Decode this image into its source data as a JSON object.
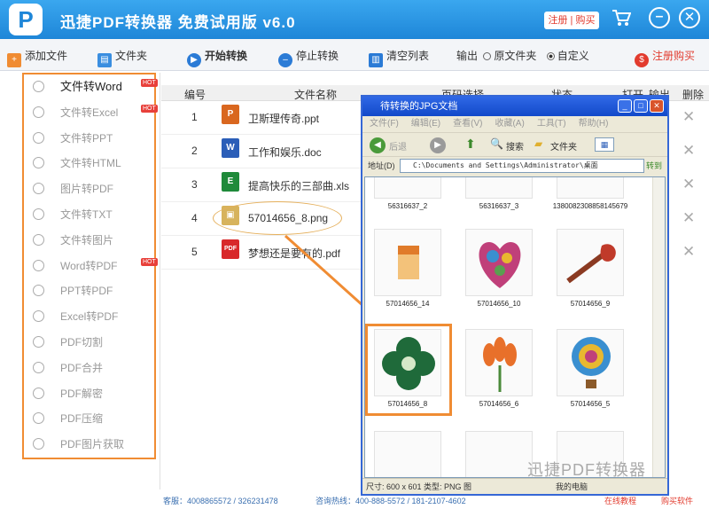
{
  "app": {
    "title": "迅捷PDF转换器 免费试用版 v6.0",
    "logo": "P",
    "register_label": "注册 | 购买"
  },
  "toolbar": {
    "add_file": "添加文件",
    "folder": "文件夹",
    "start": "开始转换",
    "stop": "停止转换",
    "clear": "清空列表",
    "output_label": "输出",
    "source_folder": "原文件夹",
    "custom": "自定义",
    "register_buy": "注册购买"
  },
  "sidebar": {
    "items": [
      {
        "label": "文件转Word",
        "hot": true
      },
      {
        "label": "文件转Excel",
        "hot": true
      },
      {
        "label": "文件转PPT",
        "hot": false
      },
      {
        "label": "文件转HTML",
        "hot": false
      },
      {
        "label": "图片转PDF",
        "hot": false
      },
      {
        "label": "文件转TXT",
        "hot": false
      },
      {
        "label": "文件转图片",
        "hot": false
      },
      {
        "label": "Word转PDF",
        "hot": true
      },
      {
        "label": "PPT转PDF",
        "hot": false
      },
      {
        "label": "Excel转PDF",
        "hot": false
      },
      {
        "label": "PDF切割",
        "hot": false
      },
      {
        "label": "PDF合并",
        "hot": false
      },
      {
        "label": "PDF解密",
        "hot": false
      },
      {
        "label": "PDF压缩",
        "hot": false
      },
      {
        "label": "PDF图片获取",
        "hot": false
      }
    ],
    "hot_badge": "HOT"
  },
  "table": {
    "headers": {
      "num": "编号",
      "name": "文件名称",
      "range": "页码选择",
      "status": "状态",
      "open": "打开",
      "output": "输出",
      "delete": "删除"
    },
    "rows": [
      {
        "num": "1",
        "name": "卫斯理传奇.ppt",
        "icon": "P",
        "color": "#d9671f"
      },
      {
        "num": "2",
        "name": "工作和娱乐.doc",
        "icon": "W",
        "color": "#2b5eb8"
      },
      {
        "num": "3",
        "name": "提高快乐的三部曲.xls",
        "icon": "E",
        "color": "#1f8a3a"
      },
      {
        "num": "4",
        "name": "57014656_8.png",
        "icon": "▣",
        "color": "#d7b35c"
      },
      {
        "num": "5",
        "name": "梦想还是要有的.pdf",
        "icon": "PDF",
        "color": "#d8282a"
      }
    ],
    "delete_glyph": "✕"
  },
  "explorer": {
    "title": "待转换的JPG文档",
    "menu": [
      "文件(F)",
      "编辑(E)",
      "查看(V)",
      "收藏(A)",
      "工具(T)",
      "帮助(H)"
    ],
    "back": "后退",
    "search": "搜索",
    "folders": "文件夹",
    "address_label": "地址(D)",
    "address": "C:\\Documents and Settings\\Administrator\\桌面",
    "go": "转到",
    "files": [
      {
        "name": "56316637_2"
      },
      {
        "name": "56316637_3"
      },
      {
        "name": "1380082308858145679"
      },
      {
        "name": "57014656_14"
      },
      {
        "name": "57014656_10"
      },
      {
        "name": "57014656_9"
      },
      {
        "name": "57014656_8"
      },
      {
        "name": "57014656_6"
      },
      {
        "name": "57014656_5"
      }
    ],
    "status_size": "尺寸: 600 x 601 类型: PNG 图",
    "status_computer": "我的电脑"
  },
  "statusbar": {
    "service": "客服：4008865572 / 326231478",
    "consult": "咨询热线：400-888-5572 / 181-2107-4602",
    "tutorial": "在线教程",
    "buy": "购买软件"
  },
  "watermark": "迅捷PDF转换器",
  "colors": {
    "brand": "#1e86d8",
    "highlight": "#f08c33",
    "title_blue": "#2f68e6"
  }
}
